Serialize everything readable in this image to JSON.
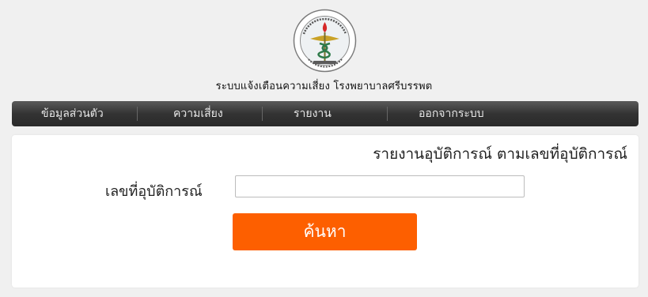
{
  "header": {
    "logo_icon": "ministry-of-public-health-caduceus-seal",
    "title": "ระบบแจ้งเตือนความเสี่ยง โรงพยาบาลศรีบรรพต"
  },
  "nav": {
    "items": [
      {
        "label": "ข้อมูลส่วนตัว"
      },
      {
        "label": "ความเสี่ยง"
      },
      {
        "label": "รายงาน"
      },
      {
        "label": "ออกจากระบบ"
      }
    ]
  },
  "report": {
    "title": "รายงานอุบัติการณ์ ตามเลขที่อุบัติการณ์",
    "field_label": "เลขที่อุบัติการณ์",
    "field_value": "",
    "search_label": "ค้นหา"
  },
  "colors": {
    "accent": "#fd5f00",
    "nav_bg": "#333333",
    "page_bg": "#f0f0f0"
  }
}
